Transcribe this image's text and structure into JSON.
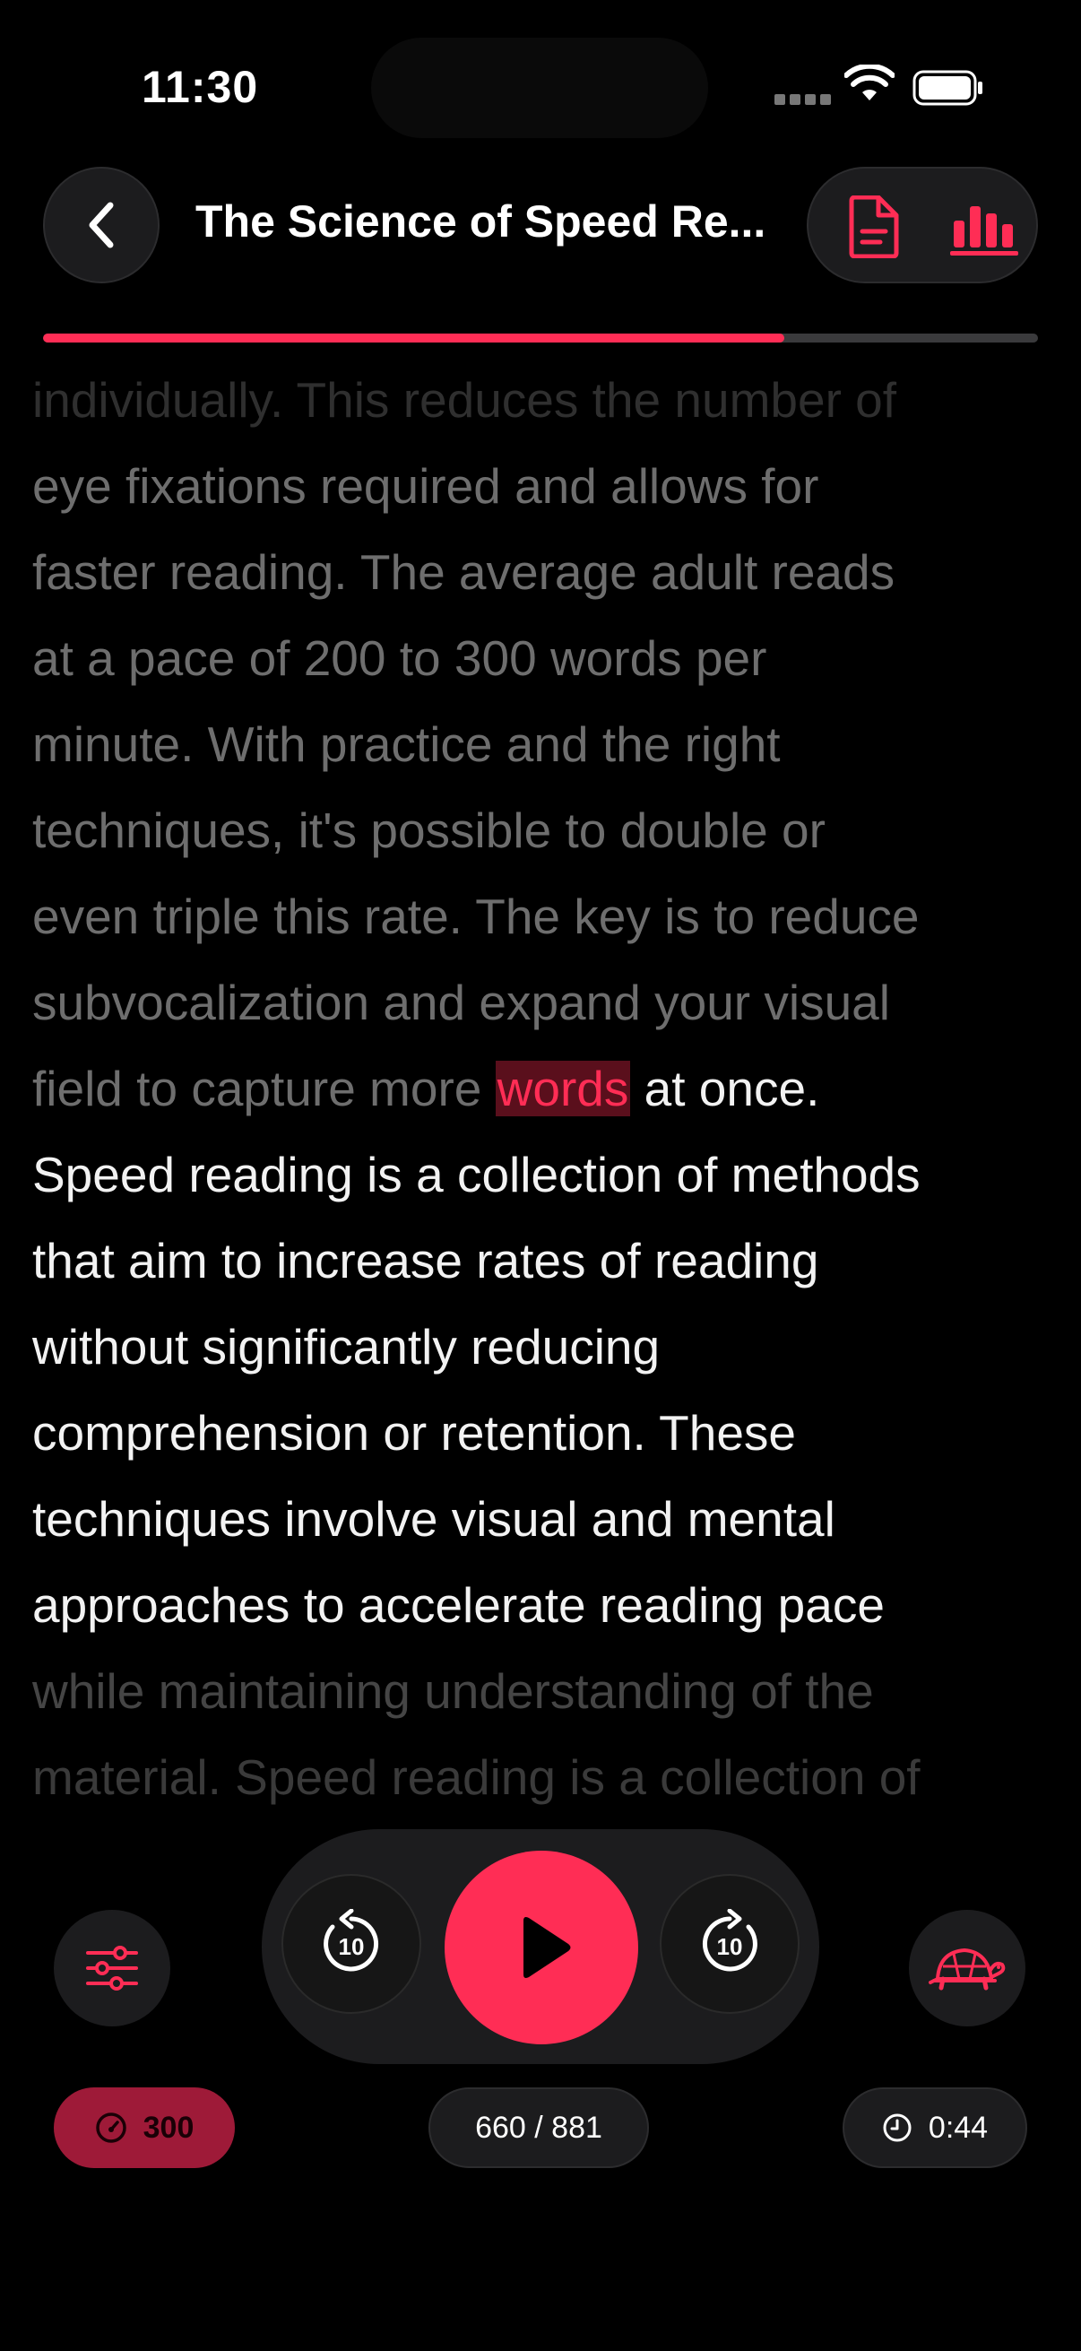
{
  "status_bar": {
    "time": "11:30"
  },
  "header": {
    "title": "The Science of Speed Re..."
  },
  "progress": {
    "fraction": 0.745
  },
  "reading": {
    "lines": [
      {
        "style": "fade1",
        "text": "individually. This reduces the number of"
      },
      {
        "style": "dim",
        "text": "eye fixations required and allows for"
      },
      {
        "style": "dim",
        "text": "faster reading. The average adult reads"
      },
      {
        "style": "dim",
        "text": "at a pace of 200 to 300 words per"
      },
      {
        "style": "dim",
        "text": "minute. With practice and the right"
      },
      {
        "style": "dim",
        "text": "techniques, it's possible to double or"
      },
      {
        "style": "dim",
        "text": "even triple this rate. The key is to reduce"
      },
      {
        "style": "dim",
        "text": "subvocalization and expand your visual"
      }
    ],
    "current_line": {
      "before": "field to capture more ",
      "highlight": "words",
      "after": " at once."
    },
    "lines_after": [
      {
        "style": "bright",
        "text": "Speed reading is a collection of methods"
      },
      {
        "style": "bright",
        "text": "that aim to increase rates of reading"
      },
      {
        "style": "bright",
        "text": "without significantly reducing"
      },
      {
        "style": "bright",
        "text": "comprehension or retention. These"
      },
      {
        "style": "bright",
        "text": "techniques involve visual and mental"
      },
      {
        "style": "bright",
        "text": "approaches to accelerate reading pace"
      },
      {
        "style": "fadeb2",
        "text": "while maintaining understanding of the"
      },
      {
        "style": "fadeb",
        "text": "material. Speed reading is a collection of"
      }
    ]
  },
  "controls": {
    "skip_back_label": "10",
    "skip_forward_label": "10"
  },
  "chips": {
    "speed": "300",
    "word_count": "660 / 881",
    "time_left": "0:44"
  },
  "icons": [
    "back-icon",
    "document-icon",
    "stats-icon",
    "settings-sliders-icon",
    "rewind-10-icon",
    "play-icon",
    "forward-10-icon",
    "turtle-icon",
    "gauge-icon",
    "clock-icon"
  ],
  "colors": {
    "accent": "#ff2d55",
    "background": "#000000",
    "surface": "#1c1c1e"
  }
}
